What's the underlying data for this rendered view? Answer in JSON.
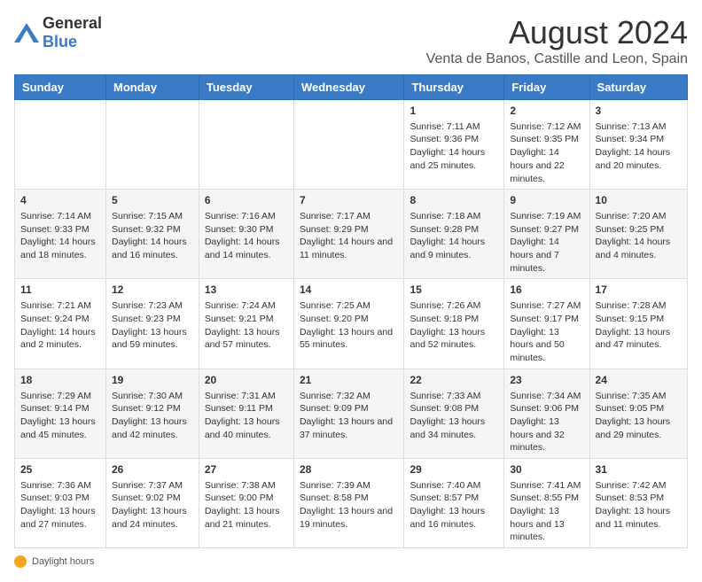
{
  "logo": {
    "text_general": "General",
    "text_blue": "Blue"
  },
  "title": "August 2024",
  "subtitle": "Venta de Banos, Castille and Leon, Spain",
  "days_of_week": [
    "Sunday",
    "Monday",
    "Tuesday",
    "Wednesday",
    "Thursday",
    "Friday",
    "Saturday"
  ],
  "footer": {
    "label": "Daylight hours"
  },
  "weeks": [
    {
      "days": [
        {
          "number": "",
          "info": ""
        },
        {
          "number": "",
          "info": ""
        },
        {
          "number": "",
          "info": ""
        },
        {
          "number": "",
          "info": ""
        },
        {
          "number": "1",
          "info": "Sunrise: 7:11 AM\nSunset: 9:36 PM\nDaylight: 14 hours\nand 25 minutes."
        },
        {
          "number": "2",
          "info": "Sunrise: 7:12 AM\nSunset: 9:35 PM\nDaylight: 14 hours\nand 22 minutes."
        },
        {
          "number": "3",
          "info": "Sunrise: 7:13 AM\nSunset: 9:34 PM\nDaylight: 14 hours\nand 20 minutes."
        }
      ]
    },
    {
      "days": [
        {
          "number": "4",
          "info": "Sunrise: 7:14 AM\nSunset: 9:33 PM\nDaylight: 14 hours\nand 18 minutes."
        },
        {
          "number": "5",
          "info": "Sunrise: 7:15 AM\nSunset: 9:32 PM\nDaylight: 14 hours\nand 16 minutes."
        },
        {
          "number": "6",
          "info": "Sunrise: 7:16 AM\nSunset: 9:30 PM\nDaylight: 14 hours\nand 14 minutes."
        },
        {
          "number": "7",
          "info": "Sunrise: 7:17 AM\nSunset: 9:29 PM\nDaylight: 14 hours\nand 11 minutes."
        },
        {
          "number": "8",
          "info": "Sunrise: 7:18 AM\nSunset: 9:28 PM\nDaylight: 14 hours\nand 9 minutes."
        },
        {
          "number": "9",
          "info": "Sunrise: 7:19 AM\nSunset: 9:27 PM\nDaylight: 14 hours\nand 7 minutes."
        },
        {
          "number": "10",
          "info": "Sunrise: 7:20 AM\nSunset: 9:25 PM\nDaylight: 14 hours\nand 4 minutes."
        }
      ]
    },
    {
      "days": [
        {
          "number": "11",
          "info": "Sunrise: 7:21 AM\nSunset: 9:24 PM\nDaylight: 14 hours\nand 2 minutes."
        },
        {
          "number": "12",
          "info": "Sunrise: 7:23 AM\nSunset: 9:23 PM\nDaylight: 13 hours\nand 59 minutes."
        },
        {
          "number": "13",
          "info": "Sunrise: 7:24 AM\nSunset: 9:21 PM\nDaylight: 13 hours\nand 57 minutes."
        },
        {
          "number": "14",
          "info": "Sunrise: 7:25 AM\nSunset: 9:20 PM\nDaylight: 13 hours\nand 55 minutes."
        },
        {
          "number": "15",
          "info": "Sunrise: 7:26 AM\nSunset: 9:18 PM\nDaylight: 13 hours\nand 52 minutes."
        },
        {
          "number": "16",
          "info": "Sunrise: 7:27 AM\nSunset: 9:17 PM\nDaylight: 13 hours\nand 50 minutes."
        },
        {
          "number": "17",
          "info": "Sunrise: 7:28 AM\nSunset: 9:15 PM\nDaylight: 13 hours\nand 47 minutes."
        }
      ]
    },
    {
      "days": [
        {
          "number": "18",
          "info": "Sunrise: 7:29 AM\nSunset: 9:14 PM\nDaylight: 13 hours\nand 45 minutes."
        },
        {
          "number": "19",
          "info": "Sunrise: 7:30 AM\nSunset: 9:12 PM\nDaylight: 13 hours\nand 42 minutes."
        },
        {
          "number": "20",
          "info": "Sunrise: 7:31 AM\nSunset: 9:11 PM\nDaylight: 13 hours\nand 40 minutes."
        },
        {
          "number": "21",
          "info": "Sunrise: 7:32 AM\nSunset: 9:09 PM\nDaylight: 13 hours\nand 37 minutes."
        },
        {
          "number": "22",
          "info": "Sunrise: 7:33 AM\nSunset: 9:08 PM\nDaylight: 13 hours\nand 34 minutes."
        },
        {
          "number": "23",
          "info": "Sunrise: 7:34 AM\nSunset: 9:06 PM\nDaylight: 13 hours\nand 32 minutes."
        },
        {
          "number": "24",
          "info": "Sunrise: 7:35 AM\nSunset: 9:05 PM\nDaylight: 13 hours\nand 29 minutes."
        }
      ]
    },
    {
      "days": [
        {
          "number": "25",
          "info": "Sunrise: 7:36 AM\nSunset: 9:03 PM\nDaylight: 13 hours\nand 27 minutes."
        },
        {
          "number": "26",
          "info": "Sunrise: 7:37 AM\nSunset: 9:02 PM\nDaylight: 13 hours\nand 24 minutes."
        },
        {
          "number": "27",
          "info": "Sunrise: 7:38 AM\nSunset: 9:00 PM\nDaylight: 13 hours\nand 21 minutes."
        },
        {
          "number": "28",
          "info": "Sunrise: 7:39 AM\nSunset: 8:58 PM\nDaylight: 13 hours\nand 19 minutes."
        },
        {
          "number": "29",
          "info": "Sunrise: 7:40 AM\nSunset: 8:57 PM\nDaylight: 13 hours\nand 16 minutes."
        },
        {
          "number": "30",
          "info": "Sunrise: 7:41 AM\nSunset: 8:55 PM\nDaylight: 13 hours\nand 13 minutes."
        },
        {
          "number": "31",
          "info": "Sunrise: 7:42 AM\nSunset: 8:53 PM\nDaylight: 13 hours\nand 11 minutes."
        }
      ]
    }
  ]
}
